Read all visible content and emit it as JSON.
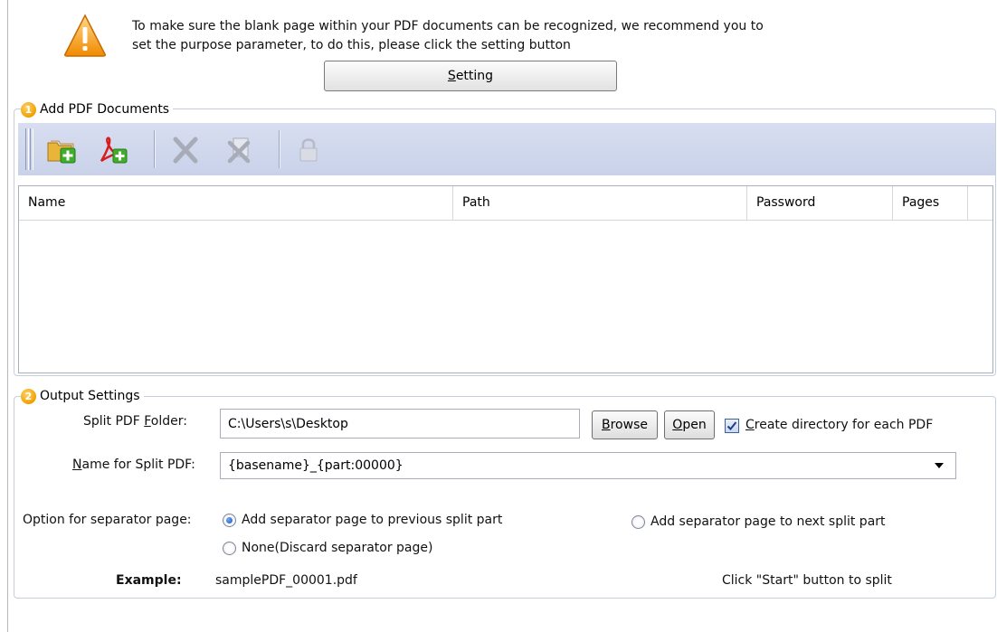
{
  "notice": {
    "line1": "To make sure the blank page within your PDF documents can be recognized, we recommend you to",
    "line2": "set the purpose parameter, to do this, please click the setting button"
  },
  "setting_button": {
    "label_prefix": "",
    "label_mnemonic": "S",
    "label_rest": "etting"
  },
  "section1": {
    "number": "1",
    "title": "Add PDF Documents",
    "toolbar_icons": [
      "add-folder-icon",
      "add-pdf-icon",
      "remove-icon",
      "remove-all-icon",
      "lock-icon"
    ],
    "columns": [
      "Name",
      "Path",
      "Password",
      "Pages"
    ]
  },
  "section2": {
    "number": "2",
    "title": "Output Settings",
    "folder_label_prefix": "Split PDF ",
    "folder_label_mnemonic": "F",
    "folder_label_rest": "older:",
    "folder_value": "C:\\Users\\s\\Desktop",
    "browse_label_mnemonic": "B",
    "browse_label_rest": "rowse",
    "open_label_mnemonic": "O",
    "open_label_rest": "pen",
    "create_dir_mnemonic": "C",
    "create_dir_rest": "reate directory for each PDF",
    "create_dir_checked": true,
    "name_label_mnemonic": "N",
    "name_label_rest": "ame for Split PDF:",
    "name_value": "{basename}_{part:00000}",
    "separator_label": "Option for separator page:",
    "separator_options": [
      {
        "label": "Add separator page to previous split part",
        "selected": true
      },
      {
        "label": "Add separator page to next split part",
        "selected": false
      },
      {
        "label": "None(Discard separator page)",
        "selected": false
      }
    ],
    "example_label": "Example:",
    "example_value": "samplePDF_00001.pdf",
    "start_hint": "Click \"Start\" button to split"
  },
  "colors": {
    "toolbar_bg": "#c9d2ea",
    "accent_orange": "#f0a000",
    "group_border": "#c7cfdc"
  }
}
